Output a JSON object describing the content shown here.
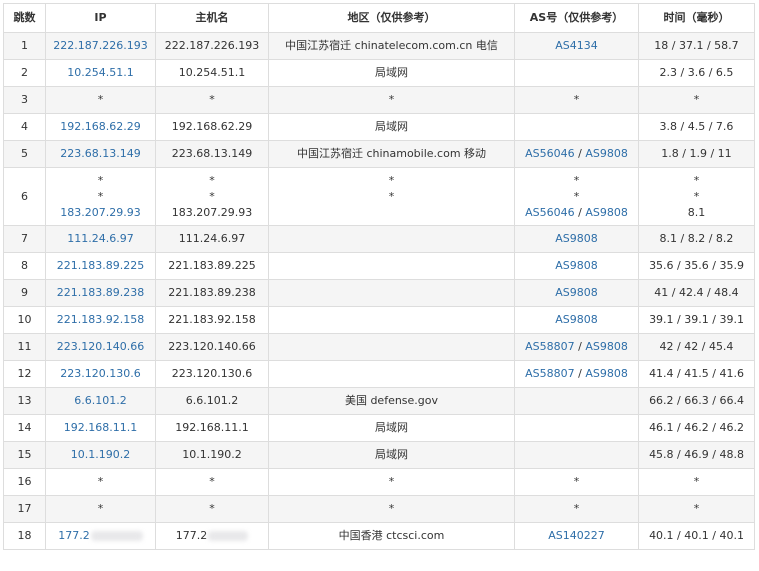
{
  "columns": {
    "hop": "跳数",
    "ip": "IP",
    "host": "主机名",
    "region": "地区（仅供参考）",
    "as": "AS号（仅供参考）",
    "time": "时间（毫秒）"
  },
  "rows": [
    {
      "hop": "1",
      "ip": [
        "222.187.226.193"
      ],
      "host": [
        "222.187.226.193"
      ],
      "region": [
        "中国江苏宿迁 chinatelecom.com.cn 电信"
      ],
      "as": [
        [
          "AS4134"
        ]
      ],
      "time": [
        "18 / 37.1 / 58.7"
      ]
    },
    {
      "hop": "2",
      "ip": [
        "10.254.51.1"
      ],
      "host": [
        "10.254.51.1"
      ],
      "region": [
        "局域网"
      ],
      "as": [
        []
      ],
      "time": [
        "2.3 / 3.6 / 6.5"
      ]
    },
    {
      "hop": "3",
      "ip": [
        "*"
      ],
      "host": [
        "*"
      ],
      "region": [
        "*"
      ],
      "as": [
        [
          "*"
        ]
      ],
      "time": [
        "*"
      ]
    },
    {
      "hop": "4",
      "ip": [
        "192.168.62.29"
      ],
      "host": [
        "192.168.62.29"
      ],
      "region": [
        "局域网"
      ],
      "as": [
        []
      ],
      "time": [
        "3.8 / 4.5 / 7.6"
      ]
    },
    {
      "hop": "5",
      "ip": [
        "223.68.13.149"
      ],
      "host": [
        "223.68.13.149"
      ],
      "region": [
        "中国江苏宿迁 chinamobile.com 移动"
      ],
      "as": [
        [
          "AS56046",
          "AS9808"
        ]
      ],
      "time": [
        "1.8 / 1.9 / 11"
      ]
    },
    {
      "hop": "6",
      "ip": [
        "*",
        "*",
        "183.207.29.93"
      ],
      "host": [
        "*",
        "*",
        "183.207.29.93"
      ],
      "region": [
        "*",
        "*",
        ""
      ],
      "as": [
        [
          "*"
        ],
        [
          "*"
        ],
        [
          "AS56046",
          "AS9808"
        ]
      ],
      "time": [
        "*",
        "*",
        "8.1"
      ]
    },
    {
      "hop": "7",
      "ip": [
        "111.24.6.97"
      ],
      "host": [
        "111.24.6.97"
      ],
      "region": [
        ""
      ],
      "as": [
        [
          "AS9808"
        ]
      ],
      "time": [
        "8.1 / 8.2 / 8.2"
      ]
    },
    {
      "hop": "8",
      "ip": [
        "221.183.89.225"
      ],
      "host": [
        "221.183.89.225"
      ],
      "region": [
        ""
      ],
      "as": [
        [
          "AS9808"
        ]
      ],
      "time": [
        "35.6 / 35.6 / 35.9"
      ]
    },
    {
      "hop": "9",
      "ip": [
        "221.183.89.238"
      ],
      "host": [
        "221.183.89.238"
      ],
      "region": [
        ""
      ],
      "as": [
        [
          "AS9808"
        ]
      ],
      "time": [
        "41 / 42.4 / 48.4"
      ]
    },
    {
      "hop": "10",
      "ip": [
        "221.183.92.158"
      ],
      "host": [
        "221.183.92.158"
      ],
      "region": [
        ""
      ],
      "as": [
        [
          "AS9808"
        ]
      ],
      "time": [
        "39.1 / 39.1 / 39.1"
      ]
    },
    {
      "hop": "11",
      "ip": [
        "223.120.140.66"
      ],
      "host": [
        "223.120.140.66"
      ],
      "region": [
        ""
      ],
      "as": [
        [
          "AS58807",
          "AS9808"
        ]
      ],
      "time": [
        "42 / 42 / 45.4"
      ]
    },
    {
      "hop": "12",
      "ip": [
        "223.120.130.6"
      ],
      "host": [
        "223.120.130.6"
      ],
      "region": [
        ""
      ],
      "as": [
        [
          "AS58807",
          "AS9808"
        ]
      ],
      "time": [
        "41.4 / 41.5 / 41.6"
      ]
    },
    {
      "hop": "13",
      "ip": [
        "6.6.101.2"
      ],
      "host": [
        "6.6.101.2"
      ],
      "region": [
        "美国 defense.gov"
      ],
      "as": [
        []
      ],
      "time": [
        "66.2 / 66.3 / 66.4"
      ]
    },
    {
      "hop": "14",
      "ip": [
        "192.168.11.1"
      ],
      "host": [
        "192.168.11.1"
      ],
      "region": [
        "局域网"
      ],
      "as": [
        []
      ],
      "time": [
        "46.1 / 46.2 / 46.2"
      ]
    },
    {
      "hop": "15",
      "ip": [
        "10.1.190.2"
      ],
      "host": [
        "10.1.190.2"
      ],
      "region": [
        "局域网"
      ],
      "as": [
        []
      ],
      "time": [
        "45.8 / 46.9 / 48.8"
      ]
    },
    {
      "hop": "16",
      "ip": [
        "*"
      ],
      "host": [
        "*"
      ],
      "region": [
        "*"
      ],
      "as": [
        [
          "*"
        ]
      ],
      "time": [
        "*"
      ]
    },
    {
      "hop": "17",
      "ip": [
        "*"
      ],
      "host": [
        "*"
      ],
      "region": [
        "*"
      ],
      "as": [
        [
          "*"
        ]
      ],
      "time": [
        "*"
      ]
    },
    {
      "hop": "18",
      "ip": [
        "177.2"
      ],
      "host": [
        "177.2"
      ],
      "region": [
        "中国香港 ctcsci.com"
      ],
      "as": [
        [
          "AS140227"
        ]
      ],
      "time": [
        "40.1 / 40.1 / 40.1"
      ],
      "redacted": true
    }
  ]
}
